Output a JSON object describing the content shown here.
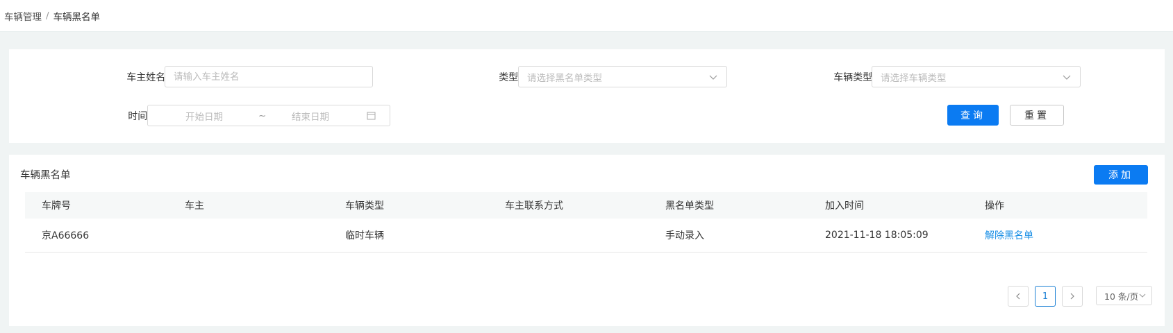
{
  "breadcrumb": {
    "root": "车辆管理",
    "separator": "/",
    "current": "车辆黑名单"
  },
  "filters": {
    "owner_name": {
      "label": "车主姓名:",
      "placeholder": "请输入车主姓名"
    },
    "type": {
      "label": "类型:",
      "placeholder": "请选择黑名单类型"
    },
    "vehicle_type": {
      "label": "车辆类型:",
      "placeholder": "请选择车辆类型"
    },
    "time": {
      "label": "时间:",
      "start_placeholder": "开始日期",
      "tilde": "~",
      "end_placeholder": "结束日期"
    },
    "search_button": "查询",
    "reset_button": "重置"
  },
  "table": {
    "title": "车辆黑名单",
    "add_button": "添加",
    "columns": [
      "车牌号",
      "车主",
      "车辆类型",
      "车主联系方式",
      "黑名单类型",
      "加入时间",
      "操作"
    ],
    "rows": [
      {
        "plate": "京A66666",
        "owner": "",
        "vehicle_type": "临时车辆",
        "contact": "",
        "blacklist_type": "手动录入",
        "joined_at": "2021-11-18 18:05:09",
        "action": "解除黑名单"
      }
    ]
  },
  "pagination": {
    "current_page": "1",
    "page_size": "10 条/页"
  },
  "colors": {
    "primary": "#0b7bf2",
    "link": "#1a8fe6",
    "background": "#f0f4f4"
  }
}
